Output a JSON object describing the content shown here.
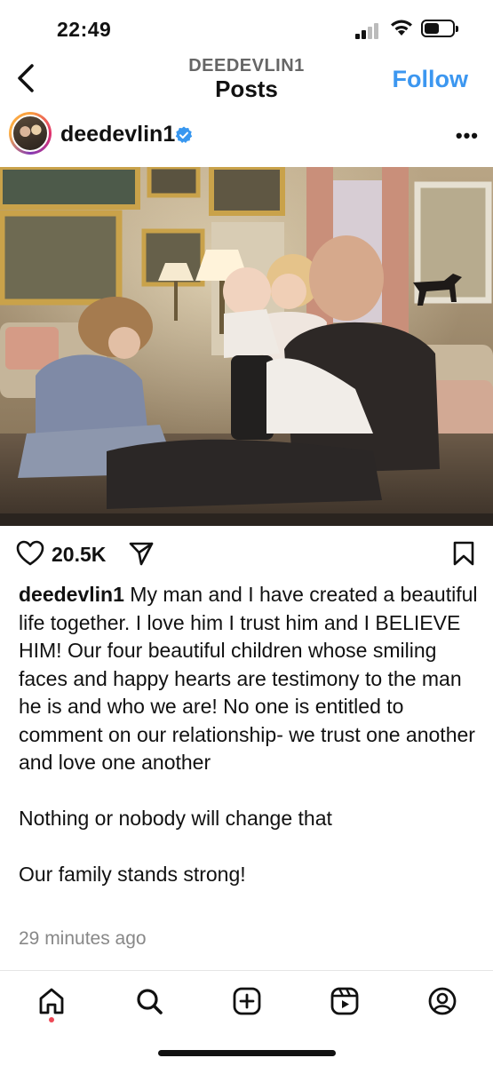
{
  "status_bar": {
    "time": "22:49"
  },
  "header": {
    "subtitle": "DEEDEVLIN1",
    "title": "Posts",
    "follow_label": "Follow"
  },
  "post": {
    "username": "deedevlin1",
    "verified": true,
    "likes": "20.5K",
    "caption_user": "deedevlin1",
    "caption_lines": [
      " My man and I have created a beautiful life together. I love him I trust him and I BELIEVE HIM! Our four beautiful children whose smiling faces and happy hearts are testimony to the man he is and who we are! No one is entitled to comment on our relationship- we trust one another and love one another",
      "Nothing or nobody will change that",
      "Our family stands strong!"
    ],
    "timestamp": "29 minutes ago"
  },
  "tab_bar": {
    "items": [
      "home-icon",
      "search-icon",
      "create-icon",
      "reels-icon",
      "profile-icon"
    ],
    "active": "home-icon"
  },
  "colors": {
    "accent": "#3c97f0",
    "verified": "#3897f0",
    "notification_dot": "#ed4956"
  }
}
